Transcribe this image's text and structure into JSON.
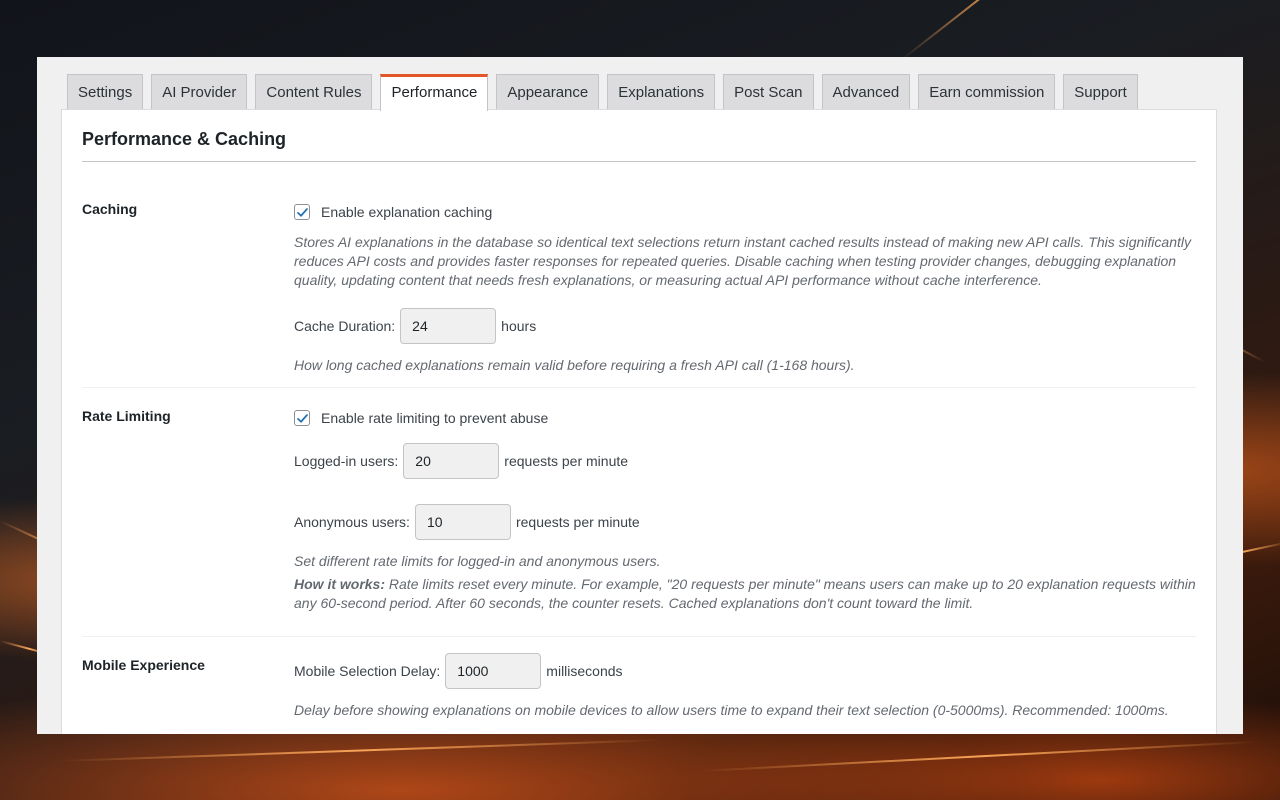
{
  "tabs": [
    {
      "label": "Settings",
      "active": false
    },
    {
      "label": "AI Provider",
      "active": false
    },
    {
      "label": "Content Rules",
      "active": false
    },
    {
      "label": "Performance",
      "active": true
    },
    {
      "label": "Appearance",
      "active": false
    },
    {
      "label": "Explanations",
      "active": false
    },
    {
      "label": "Post Scan",
      "active": false
    },
    {
      "label": "Advanced",
      "active": false
    },
    {
      "label": "Earn commission",
      "active": false
    },
    {
      "label": "Support",
      "active": false
    }
  ],
  "page": {
    "title": "Performance & Caching"
  },
  "caching": {
    "label": "Caching",
    "enable_label": "Enable explanation caching",
    "enabled": true,
    "description": "Stores AI explanations in the database so identical text selections return instant cached results instead of making new API calls. This significantly reduces API costs and provides faster responses for repeated queries. Disable caching when testing provider changes, debugging explanation quality, updating content that needs fresh explanations, or measuring actual API performance without cache interference.",
    "duration_label": "Cache Duration:",
    "duration_value": "24",
    "duration_unit": "hours",
    "duration_help": "How long cached explanations remain valid before requiring a fresh API call (1-168 hours)."
  },
  "rate_limiting": {
    "label": "Rate Limiting",
    "enable_label": "Enable rate limiting to prevent abuse",
    "enabled": true,
    "logged_in_label": "Logged-in users:",
    "logged_in_value": "20",
    "logged_in_unit": "requests per minute",
    "anonymous_label": "Anonymous users:",
    "anonymous_value": "10",
    "anonymous_unit": "requests per minute",
    "help": "Set different rate limits for logged-in and anonymous users.",
    "how_it_works_label": "How it works:",
    "how_it_works_text": " Rate limits reset every minute. For example, \"20 requests per minute\" means users can make up to 20 explanation requests within any 60-second period. After 60 seconds, the counter resets. Cached explanations don't count toward the limit."
  },
  "mobile": {
    "label": "Mobile Experience",
    "delay_label": "Mobile Selection Delay:",
    "delay_value": "1000",
    "delay_unit": "milliseconds",
    "delay_help": "Delay before showing explanations on mobile devices to allow users time to expand their text selection (0-5000ms). Recommended: 1000ms."
  },
  "colors": {
    "accent": "#e2562a",
    "checkbox_blue": "#2271b1"
  }
}
